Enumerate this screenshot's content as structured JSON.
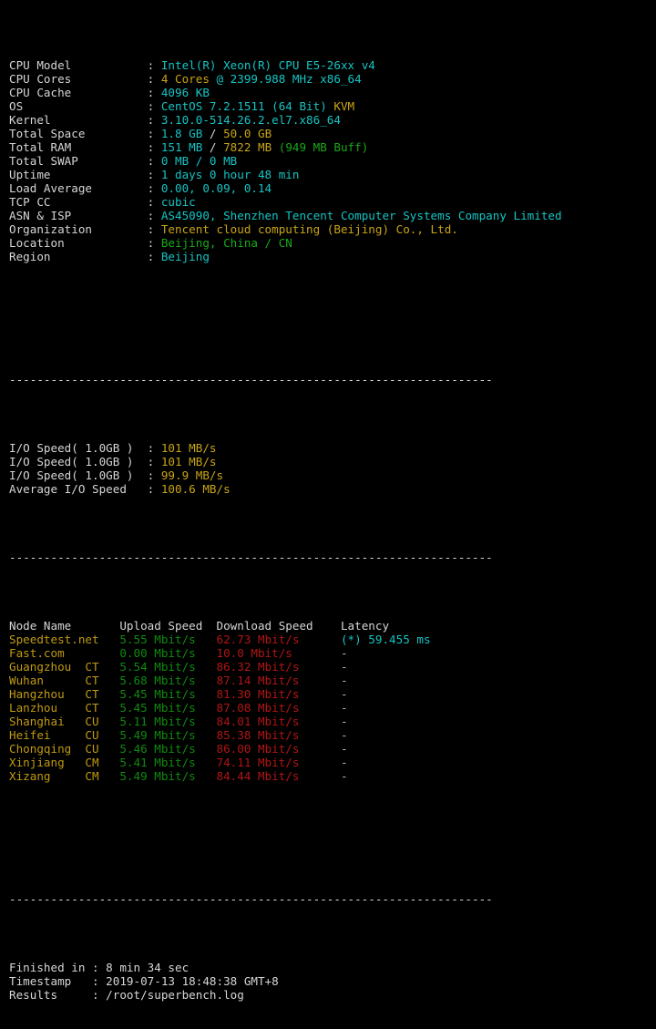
{
  "terminal": {
    "background": "#000000",
    "foreground": "#d6d6d6",
    "palette": {
      "cyan": "#17c3c3",
      "green": "#1aa81a",
      "dim_green": "#0f8a0f",
      "yellow": "#c8a415",
      "gold": "#c09a12",
      "red": "#b01515",
      "white": "#d6d6d6"
    }
  },
  "separator": "----------------------------------------------------------------------",
  "system_info": {
    "label_width": 20,
    "rows": [
      {
        "label": "CPU Model",
        "sep": ":",
        "value": "Intel(R) Xeon(R) CPU E5-26xx v4"
      },
      {
        "label": "CPU Cores",
        "sep": ":",
        "value": "4 Cores @ 2399.988 MHz x86_64"
      },
      {
        "label": "CPU Cache",
        "sep": ":",
        "value": "4096 KB"
      },
      {
        "label": "OS",
        "sep": ":",
        "value": "CentOS 7.2.1511 (64 Bit) KVM"
      },
      {
        "label": "Kernel",
        "sep": ":",
        "value": "3.10.0-514.26.2.el7.x86_64"
      },
      {
        "label": "Total Space",
        "sep": ":",
        "value": "1.8 GB / 50.0 GB"
      },
      {
        "label": "Total RAM",
        "sep": ":",
        "value": "151 MB / 7822 MB (949 MB Buff)"
      },
      {
        "label": "Total SWAP",
        "sep": ":",
        "value": "0 MB / 0 MB"
      },
      {
        "label": "Uptime",
        "sep": ":",
        "value": "1 days 0 hour 48 min"
      },
      {
        "label": "Load Average",
        "sep": ":",
        "value": "0.00, 0.09, 0.14"
      },
      {
        "label": "TCP CC",
        "sep": ":",
        "value": "cubic"
      },
      {
        "label": "ASN & ISP",
        "sep": ":",
        "value": "AS45090, Shenzhen Tencent Computer Systems Company Limited"
      },
      {
        "label": "Organization",
        "sep": ":",
        "value": "Tencent cloud computing (Beijing) Co., Ltd."
      },
      {
        "label": "Location",
        "sep": ":",
        "value": "Beijing, China / CN"
      },
      {
        "label": "Region",
        "sep": ":",
        "value": "Beijing"
      }
    ],
    "parts": {
      "cpu_model": "Intel(R) Xeon(R) CPU E5-26xx v4",
      "cpu_cores_count": "4 Cores",
      "cpu_cores_rest": " @ 2399.988 MHz x86_64",
      "cpu_cache": "4096 KB",
      "os_name": "CentOS 7.2.1511 (64 Bit) ",
      "os_virt": "KVM",
      "kernel": "3.10.0-514.26.2.el7.x86_64",
      "space_used": "1.8 GB",
      "space_slash": " / ",
      "space_total": "50.0 GB",
      "ram_used": "151 MB",
      "ram_slash": " / ",
      "ram_total": "7822 MB",
      "ram_buff": " (949 MB Buff)",
      "swap": "0 MB / 0 MB",
      "uptime": "1 days 0 hour 48 min",
      "load_average": "0.00, 0.09, 0.14",
      "tcp_cc": "cubic",
      "asn_isp": "AS45090, Shenzhen Tencent Computer Systems Company Limited",
      "organization": "Tencent cloud computing (Beijing) Co., Ltd.",
      "location": "Beijing, China / CN",
      "region": "Beijing"
    }
  },
  "io_tests": {
    "rows": [
      {
        "label": "I/O Speed( 1.0GB )",
        "sep": ":",
        "value": "101 MB/s"
      },
      {
        "label": "I/O Speed( 1.0GB )",
        "sep": ":",
        "value": "101 MB/s"
      },
      {
        "label": "I/O Speed( 1.0GB )",
        "sep": ":",
        "value": "99.9 MB/s"
      },
      {
        "label": "Average I/O Speed",
        "sep": ":",
        "value": "100.6 MB/s"
      }
    ]
  },
  "speedtest": {
    "headers": {
      "node_name": "Node Name",
      "upload": "Upload Speed",
      "download": "Download Speed",
      "latency": "Latency"
    },
    "rows": [
      {
        "node": "Speedtest.net",
        "carrier": "",
        "upload": "5.55 Mbit/s",
        "download": "62.73 Mbit/s",
        "latency": "(*) 59.455 ms",
        "latency_empty": false
      },
      {
        "node": "Fast.com",
        "carrier": "",
        "upload": "0.00 Mbit/s",
        "download": "10.0 Mbit/s",
        "latency": "-",
        "latency_empty": true
      },
      {
        "node": "Guangzhou",
        "carrier": "CT",
        "upload": "5.54 Mbit/s",
        "download": "86.32 Mbit/s",
        "latency": "-",
        "latency_empty": true
      },
      {
        "node": "Wuhan",
        "carrier": "CT",
        "upload": "5.68 Mbit/s",
        "download": "87.14 Mbit/s",
        "latency": "-",
        "latency_empty": true
      },
      {
        "node": "Hangzhou",
        "carrier": "CT",
        "upload": "5.45 Mbit/s",
        "download": "81.30 Mbit/s",
        "latency": "-",
        "latency_empty": true
      },
      {
        "node": "Lanzhou",
        "carrier": "CT",
        "upload": "5.45 Mbit/s",
        "download": "87.08 Mbit/s",
        "latency": "-",
        "latency_empty": true
      },
      {
        "node": "Shanghai",
        "carrier": "CU",
        "upload": "5.11 Mbit/s",
        "download": "84.01 Mbit/s",
        "latency": "-",
        "latency_empty": true
      },
      {
        "node": "Heifei",
        "carrier": "CU",
        "upload": "5.49 Mbit/s",
        "download": "85.38 Mbit/s",
        "latency": "-",
        "latency_empty": true
      },
      {
        "node": "Chongqing",
        "carrier": "CU",
        "upload": "5.46 Mbit/s",
        "download": "86.00 Mbit/s",
        "latency": "-",
        "latency_empty": true
      },
      {
        "node": "Xinjiang",
        "carrier": "CM",
        "upload": "5.41 Mbit/s",
        "download": "74.11 Mbit/s",
        "latency": "-",
        "latency_empty": true
      },
      {
        "node": "Xizang",
        "carrier": "CM",
        "upload": "5.49 Mbit/s",
        "download": "84.44 Mbit/s",
        "latency": "-",
        "latency_empty": true
      }
    ]
  },
  "summary": {
    "rows": [
      {
        "label": "Finished in",
        "sep": ":",
        "value": "8 min 34 sec"
      },
      {
        "label": "Timestamp",
        "sep": ":",
        "value": "2019-07-13 18:48:38 GMT+8"
      },
      {
        "label": "Results",
        "sep": ":",
        "value": "/root/superbench.log"
      }
    ]
  }
}
